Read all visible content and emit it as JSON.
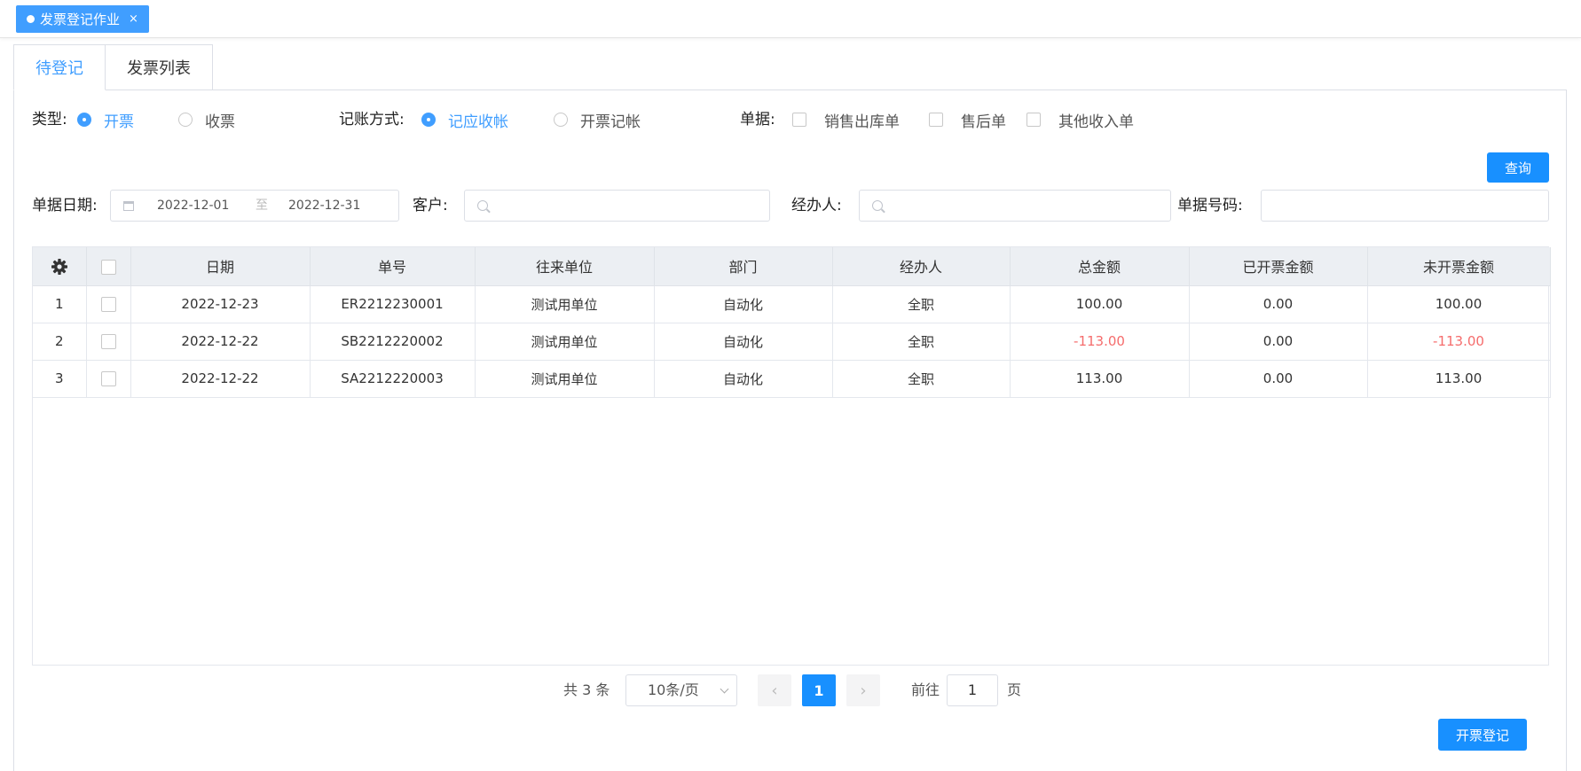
{
  "page_tag": {
    "label": "发票登记作业",
    "close": "×"
  },
  "tabs": [
    {
      "label": "待登记"
    },
    {
      "label": "发票列表"
    }
  ],
  "filters": {
    "type_label": "类型:",
    "type_options": [
      {
        "label": "开票",
        "selected": true
      },
      {
        "label": "收票",
        "selected": false
      }
    ],
    "method_label": "记账方式:",
    "method_options": [
      {
        "label": "记应收帐",
        "selected": true
      },
      {
        "label": "开票记帐",
        "selected": false
      }
    ],
    "doc_label": "单据:",
    "doc_options": [
      {
        "label": "销售出库单"
      },
      {
        "label": "售后单"
      },
      {
        "label": "其他收入单"
      }
    ],
    "query_button": "查询",
    "date_label": "单据日期:",
    "date_start": "2022-12-01",
    "date_sep": "至",
    "date_end": "2022-12-31",
    "customer_label": "客户:",
    "handler_label": "经办人:",
    "docno_label": "单据号码:"
  },
  "table": {
    "columns": [
      "日期",
      "单号",
      "往来单位",
      "部门",
      "经办人",
      "总金额",
      "已开票金额",
      "未开票金额"
    ],
    "rows": [
      {
        "no": "1",
        "date": "2022-12-23",
        "code": "ER2212230001",
        "partner": "测试用单位",
        "dept": "自动化",
        "handler": "全职",
        "total": "100.00",
        "invoiced": "0.00",
        "uninvoiced": "100.00"
      },
      {
        "no": "2",
        "date": "2022-12-22",
        "code": "SB2212220002",
        "partner": "测试用单位",
        "dept": "自动化",
        "handler": "全职",
        "total": "-113.00",
        "invoiced": "0.00",
        "uninvoiced": "-113.00"
      },
      {
        "no": "3",
        "date": "2022-12-22",
        "code": "SA2212220003",
        "partner": "测试用单位",
        "dept": "自动化",
        "handler": "全职",
        "total": "113.00",
        "invoiced": "0.00",
        "uninvoiced": "113.00"
      }
    ]
  },
  "pager": {
    "total": "共 3 条",
    "page_size": "10条/页",
    "current_page": "1",
    "goto_label": "前往",
    "goto_value": "1",
    "goto_suffix": "页"
  },
  "register_button": "开票登记",
  "colors": {
    "primary": "#1890ff",
    "negative": "#f56c6c"
  }
}
